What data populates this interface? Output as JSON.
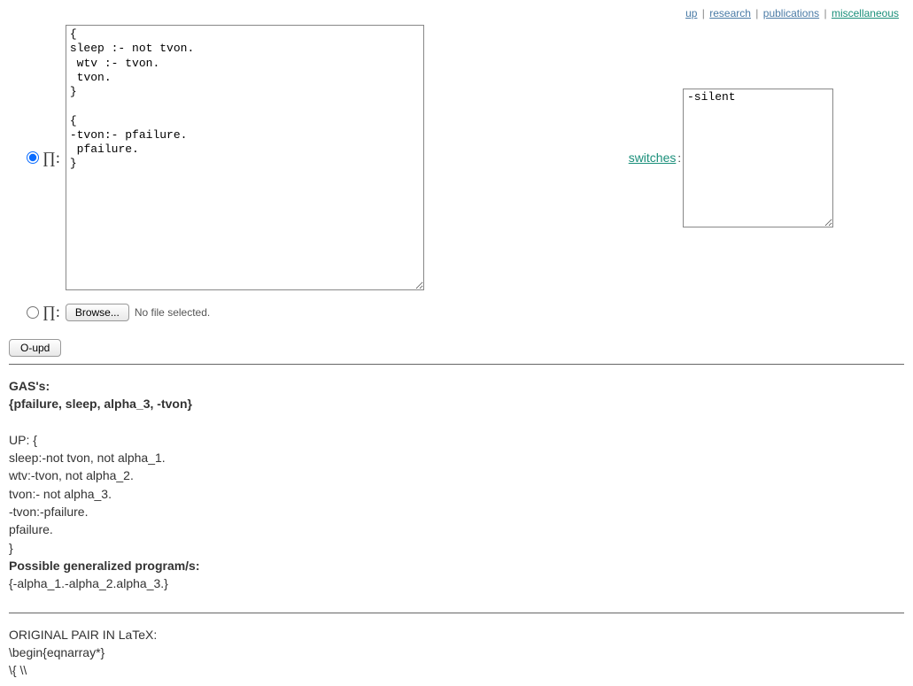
{
  "nav": {
    "up": "up",
    "research": "research",
    "publications": "publications",
    "miscellaneous": "miscellaneous"
  },
  "pi_label": "∏:",
  "program_text": "{\nsleep :- not tvon.\n wtv :- tvon.\n tvon.\n}\n\n{\n-tvon:- pfailure.\n pfailure.\n}",
  "switches_label": "switches",
  "switches_text": "-silent",
  "browse_label": "Browse...",
  "no_file_label": "No file selected.",
  "submit_label": "O-upd",
  "results": {
    "gas_label": "GAS's:",
    "gas_set": "{pfailure, sleep, alpha_3, -tvon}",
    "up_block": "UP: {\nsleep:-not tvon, not alpha_1.\nwtv:-tvon, not alpha_2.\ntvon:- not alpha_3.\n-tvon:-pfailure.\npfailure.\n}",
    "possible_label": "Possible generalized program/s:",
    "possible_set": "{-alpha_1.-alpha_2.alpha_3.}",
    "latex_header": "ORIGINAL PAIR IN LaTeX:",
    "latex_begin": "\\begin{eqnarray*}",
    "latex_frag": "\\{ \\\\"
  }
}
